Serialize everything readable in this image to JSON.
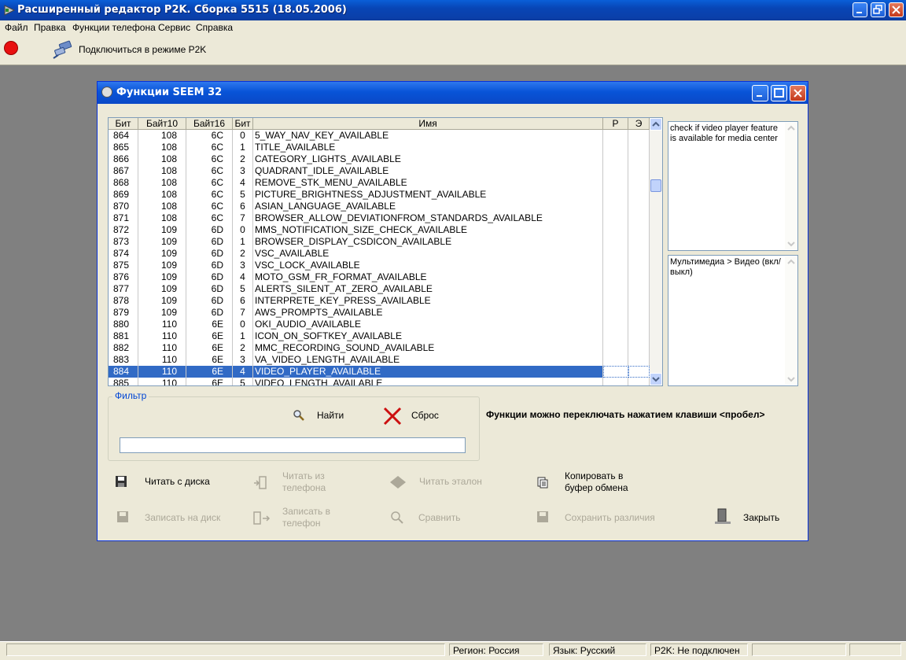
{
  "window": {
    "title": "Расширенный редактор P2K. Сборка 5515 (18.05.2006)"
  },
  "menu": [
    "Файл",
    "Правка",
    "Функции телефона",
    "Сервис",
    "Справка"
  ],
  "toolbar": {
    "connect_label": "Подключиться в режиме P2K"
  },
  "dialog": {
    "title": "Функции SEEM 32",
    "columns": [
      "Бит",
      "Байт10",
      "Байт16",
      "Бит",
      "Имя",
      "Р",
      "Э"
    ],
    "rows": [
      {
        "bit": "864",
        "b10": "108",
        "b16": "6C",
        "b": "0",
        "name": "5_WAY_NAV_KEY_AVAILABLE"
      },
      {
        "bit": "865",
        "b10": "108",
        "b16": "6C",
        "b": "1",
        "name": "TITLE_AVAILABLE"
      },
      {
        "bit": "866",
        "b10": "108",
        "b16": "6C",
        "b": "2",
        "name": "CATEGORY_LIGHTS_AVAILABLE"
      },
      {
        "bit": "867",
        "b10": "108",
        "b16": "6C",
        "b": "3",
        "name": "QUADRANT_IDLE_AVAILABLE"
      },
      {
        "bit": "868",
        "b10": "108",
        "b16": "6C",
        "b": "4",
        "name": "REMOVE_STK_MENU_AVAILABLE"
      },
      {
        "bit": "869",
        "b10": "108",
        "b16": "6C",
        "b": "5",
        "name": "PICTURE_BRIGHTNESS_ADJUSTMENT_AVAILABLE"
      },
      {
        "bit": "870",
        "b10": "108",
        "b16": "6C",
        "b": "6",
        "name": "ASIAN_LANGUAGE_AVAILABLE"
      },
      {
        "bit": "871",
        "b10": "108",
        "b16": "6C",
        "b": "7",
        "name": "BROWSER_ALLOW_DEVIATIONFROM_STANDARDS_AVAILABLE"
      },
      {
        "bit": "872",
        "b10": "109",
        "b16": "6D",
        "b": "0",
        "name": "MMS_NOTIFICATION_SIZE_CHECK_AVAILABLE"
      },
      {
        "bit": "873",
        "b10": "109",
        "b16": "6D",
        "b": "1",
        "name": "BROWSER_DISPLAY_CSDICON_AVAILABLE"
      },
      {
        "bit": "874",
        "b10": "109",
        "b16": "6D",
        "b": "2",
        "name": "VSC_AVAILABLE"
      },
      {
        "bit": "875",
        "b10": "109",
        "b16": "6D",
        "b": "3",
        "name": "VSC_LOCK_AVAILABLE"
      },
      {
        "bit": "876",
        "b10": "109",
        "b16": "6D",
        "b": "4",
        "name": "MOTO_GSM_FR_FORMAT_AVAILABLE"
      },
      {
        "bit": "877",
        "b10": "109",
        "b16": "6D",
        "b": "5",
        "name": "ALERTS_SILENT_AT_ZERO_AVAILABLE"
      },
      {
        "bit": "878",
        "b10": "109",
        "b16": "6D",
        "b": "6",
        "name": "INTERPRETE_KEY_PRESS_AVAILABLE"
      },
      {
        "bit": "879",
        "b10": "109",
        "b16": "6D",
        "b": "7",
        "name": "AWS_PROMPTS_AVAILABLE"
      },
      {
        "bit": "880",
        "b10": "110",
        "b16": "6E",
        "b": "0",
        "name": "OKI_AUDIO_AVAILABLE"
      },
      {
        "bit": "881",
        "b10": "110",
        "b16": "6E",
        "b": "1",
        "name": "ICON_ON_SOFTKEY_AVAILABLE"
      },
      {
        "bit": "882",
        "b10": "110",
        "b16": "6E",
        "b": "2",
        "name": "MMC_RECORDING_SOUND_AVAILABLE"
      },
      {
        "bit": "883",
        "b10": "110",
        "b16": "6E",
        "b": "3",
        "name": "VA_VIDEO_LENGTH_AVAILABLE"
      },
      {
        "bit": "884",
        "b10": "110",
        "b16": "6E",
        "b": "4",
        "name": "VIDEO_PLAYER_AVAILABLE"
      },
      {
        "bit": "885",
        "b10": "110",
        "b16": "6E",
        "b": "5",
        "name": "VIDEO_LENGTH_AVAILABLE"
      }
    ],
    "selected_bit": "884",
    "description": "check if video player feature is available for media center",
    "category": "Мультимедиа > Видео (вкл/выкл)",
    "filter": {
      "legend": "Фильтр",
      "find_label": "Найти",
      "reset_label": "Сброс",
      "value": ""
    },
    "hint": "Функции можно переключать нажатием клавиши <пробел>",
    "actions": {
      "read_disk": "Читать с диска",
      "read_phone": "Читать из телефона",
      "read_ref": "Читать эталон",
      "copy_clip": "Копировать в буфер обмена",
      "write_disk": "Записать на диск",
      "write_phone": "Записать в телефон",
      "compare": "Сравнить",
      "save_diff": "Сохранить различия",
      "close": "Закрыть"
    }
  },
  "status": {
    "region": "Регион: Россия",
    "language": "Язык: Русский",
    "p2k": "P2K: Не подключен"
  },
  "colors": {
    "selection": "#316ac5",
    "title_blue": "#0854d8",
    "face": "#ece9d8"
  }
}
